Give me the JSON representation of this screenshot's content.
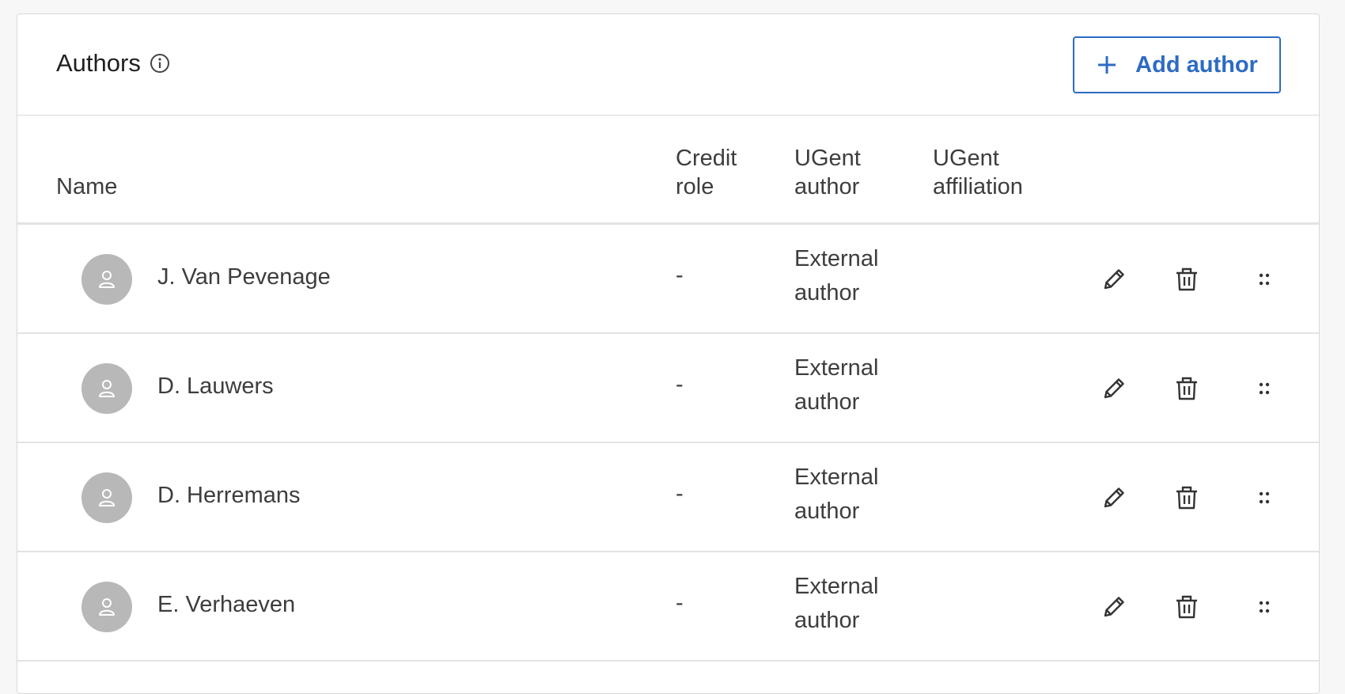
{
  "panel": {
    "title": "Authors",
    "add_button_label": "Add author"
  },
  "table": {
    "columns": {
      "name": "Name",
      "credit_role": "Credit role",
      "ugent_author": "UGent author",
      "ugent_affiliation": "UGent affiliation"
    },
    "rows": [
      {
        "name": "J. Van Pevenage",
        "credit_role": "-",
        "ugent_author": "External author",
        "ugent_affiliation": ""
      },
      {
        "name": "D. Lauwers",
        "credit_role": "-",
        "ugent_author": "External author",
        "ugent_affiliation": ""
      },
      {
        "name": "D. Herremans",
        "credit_role": "-",
        "ugent_author": "External author",
        "ugent_affiliation": ""
      },
      {
        "name": "E. Verhaeven",
        "credit_role": "-",
        "ugent_author": "External author",
        "ugent_affiliation": ""
      }
    ]
  },
  "icons": {
    "info": "info-icon",
    "plus": "plus-icon",
    "avatar": "user-icon",
    "edit": "pencil-icon",
    "delete": "trash-icon",
    "drag": "drag-handle-icon"
  },
  "colors": {
    "accent": "#2d6bc4",
    "avatar_bg": "#b8b8b8",
    "border": "#d9d9d9"
  }
}
